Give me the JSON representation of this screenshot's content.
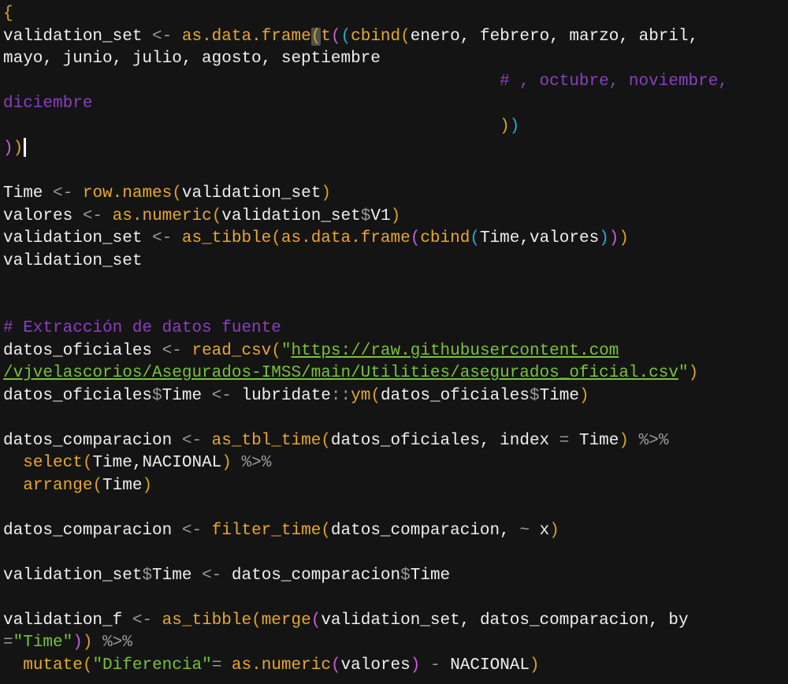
{
  "editor": {
    "lines": [
      [
        {
          "t": "{",
          "c": "b1"
        }
      ],
      [
        {
          "t": "validation_set ",
          "c": "def"
        },
        {
          "t": "<-",
          "c": "op"
        },
        {
          "t": " ",
          "c": "def"
        },
        {
          "t": "as.data.frame",
          "c": "fun"
        },
        {
          "t": "(",
          "c": "b1",
          "m": 1
        },
        {
          "t": "t",
          "c": "fun"
        },
        {
          "t": "(",
          "c": "b2"
        },
        {
          "t": "(",
          "c": "b3"
        },
        {
          "t": "cbind",
          "c": "fun"
        },
        {
          "t": "(",
          "c": "b1"
        },
        {
          "t": "enero, febrero, marzo, abril,",
          "c": "def"
        }
      ],
      [
        {
          "t": "mayo, junio, julio, agosto, septiembre",
          "c": "def"
        }
      ],
      [
        {
          "t": "                                                  # , octubre, noviembre,",
          "c": "com"
        }
      ],
      [
        {
          "t": "diciembre",
          "c": "com"
        }
      ],
      [
        {
          "t": "                                                  ",
          "c": "def"
        },
        {
          "t": ")",
          "c": "b1"
        },
        {
          "t": ")",
          "c": "b3"
        }
      ],
      [
        {
          "t": ")",
          "c": "b2"
        },
        {
          "t": ")",
          "c": "b1"
        },
        {
          "t": "",
          "c": "def",
          "cur": 1
        }
      ],
      [],
      [
        {
          "t": "Time ",
          "c": "def"
        },
        {
          "t": "<-",
          "c": "op"
        },
        {
          "t": " ",
          "c": "def"
        },
        {
          "t": "row.names",
          "c": "fun"
        },
        {
          "t": "(",
          "c": "b1"
        },
        {
          "t": "validation_set",
          "c": "def"
        },
        {
          "t": ")",
          "c": "b1"
        }
      ],
      [
        {
          "t": "valores ",
          "c": "def"
        },
        {
          "t": "<-",
          "c": "op"
        },
        {
          "t": " ",
          "c": "def"
        },
        {
          "t": "as.numeric",
          "c": "fun"
        },
        {
          "t": "(",
          "c": "b1"
        },
        {
          "t": "validation_set",
          "c": "def"
        },
        {
          "t": "$",
          "c": "op"
        },
        {
          "t": "V1",
          "c": "def"
        },
        {
          "t": ")",
          "c": "b1"
        }
      ],
      [
        {
          "t": "validation_set ",
          "c": "def"
        },
        {
          "t": "<-",
          "c": "op"
        },
        {
          "t": " ",
          "c": "def"
        },
        {
          "t": "as_tibble",
          "c": "fun"
        },
        {
          "t": "(",
          "c": "b1"
        },
        {
          "t": "as.data.frame",
          "c": "fun"
        },
        {
          "t": "(",
          "c": "b2"
        },
        {
          "t": "cbind",
          "c": "fun"
        },
        {
          "t": "(",
          "c": "b3"
        },
        {
          "t": "Time,valores",
          "c": "def"
        },
        {
          "t": ")",
          "c": "b3"
        },
        {
          "t": ")",
          "c": "b2"
        },
        {
          "t": ")",
          "c": "b1"
        }
      ],
      [
        {
          "t": "validation_set",
          "c": "def"
        }
      ],
      [],
      [],
      [
        {
          "t": "# Extracción de datos fuente",
          "c": "com"
        }
      ],
      [
        {
          "t": "datos_oficiales ",
          "c": "def"
        },
        {
          "t": "<-",
          "c": "op"
        },
        {
          "t": " ",
          "c": "def"
        },
        {
          "t": "read_csv",
          "c": "fun"
        },
        {
          "t": "(",
          "c": "b1"
        },
        {
          "t": "\"",
          "c": "str"
        },
        {
          "t": "https://raw.githubusercontent.com",
          "c": "url"
        }
      ],
      [
        {
          "t": "/vjvelascorios/Asegurados-IMSS/main/Utilities/asegurados_oficial.csv",
          "c": "url"
        },
        {
          "t": "\"",
          "c": "str"
        },
        {
          "t": ")",
          "c": "b1"
        }
      ],
      [
        {
          "t": "datos_oficiales",
          "c": "def"
        },
        {
          "t": "$",
          "c": "op"
        },
        {
          "t": "Time ",
          "c": "def"
        },
        {
          "t": "<-",
          "c": "op"
        },
        {
          "t": " lubridate",
          "c": "def"
        },
        {
          "t": "::",
          "c": "op"
        },
        {
          "t": "ym",
          "c": "fun"
        },
        {
          "t": "(",
          "c": "b1"
        },
        {
          "t": "datos_oficiales",
          "c": "def"
        },
        {
          "t": "$",
          "c": "op"
        },
        {
          "t": "Time",
          "c": "def"
        },
        {
          "t": ")",
          "c": "b1"
        }
      ],
      [],
      [
        {
          "t": "datos_comparacion ",
          "c": "def"
        },
        {
          "t": "<-",
          "c": "op"
        },
        {
          "t": " ",
          "c": "def"
        },
        {
          "t": "as_tbl_time",
          "c": "fun"
        },
        {
          "t": "(",
          "c": "b1"
        },
        {
          "t": "datos_oficiales, index ",
          "c": "def"
        },
        {
          "t": "=",
          "c": "op"
        },
        {
          "t": " Time",
          "c": "def"
        },
        {
          "t": ")",
          "c": "b1"
        },
        {
          "t": " ",
          "c": "def"
        },
        {
          "t": "%>%",
          "c": "op"
        }
      ],
      [
        {
          "t": "  ",
          "c": "def"
        },
        {
          "t": "select",
          "c": "fun"
        },
        {
          "t": "(",
          "c": "b1"
        },
        {
          "t": "Time,NACIONAL",
          "c": "def"
        },
        {
          "t": ")",
          "c": "b1"
        },
        {
          "t": " ",
          "c": "def"
        },
        {
          "t": "%>%",
          "c": "op"
        }
      ],
      [
        {
          "t": "  ",
          "c": "def"
        },
        {
          "t": "arrange",
          "c": "fun"
        },
        {
          "t": "(",
          "c": "b1"
        },
        {
          "t": "Time",
          "c": "def"
        },
        {
          "t": ")",
          "c": "b1"
        }
      ],
      [],
      [
        {
          "t": "datos_comparacion ",
          "c": "def"
        },
        {
          "t": "<-",
          "c": "op"
        },
        {
          "t": " ",
          "c": "def"
        },
        {
          "t": "filter_time",
          "c": "fun"
        },
        {
          "t": "(",
          "c": "b1"
        },
        {
          "t": "datos_comparacion, ",
          "c": "def"
        },
        {
          "t": "~",
          "c": "op"
        },
        {
          "t": " x",
          "c": "def"
        },
        {
          "t": ")",
          "c": "b1"
        }
      ],
      [],
      [
        {
          "t": "validation_set",
          "c": "def"
        },
        {
          "t": "$",
          "c": "op"
        },
        {
          "t": "Time ",
          "c": "def"
        },
        {
          "t": "<-",
          "c": "op"
        },
        {
          "t": " datos_comparacion",
          "c": "def"
        },
        {
          "t": "$",
          "c": "op"
        },
        {
          "t": "Time",
          "c": "def"
        }
      ],
      [],
      [
        {
          "t": "validation_f ",
          "c": "def"
        },
        {
          "t": "<-",
          "c": "op"
        },
        {
          "t": " ",
          "c": "def"
        },
        {
          "t": "as_tibble",
          "c": "fun"
        },
        {
          "t": "(",
          "c": "b1"
        },
        {
          "t": "merge",
          "c": "fun"
        },
        {
          "t": "(",
          "c": "b2"
        },
        {
          "t": "validation_set, datos_comparacion, by",
          "c": "def"
        }
      ],
      [
        {
          "t": "=",
          "c": "op"
        },
        {
          "t": "\"Time\"",
          "c": "str"
        },
        {
          "t": ")",
          "c": "b2"
        },
        {
          "t": ")",
          "c": "b1"
        },
        {
          "t": " ",
          "c": "def"
        },
        {
          "t": "%>%",
          "c": "op"
        }
      ],
      [
        {
          "t": "  ",
          "c": "def"
        },
        {
          "t": "mutate",
          "c": "fun"
        },
        {
          "t": "(",
          "c": "b1"
        },
        {
          "t": "\"Diferencia\"",
          "c": "str"
        },
        {
          "t": "=",
          "c": "op"
        },
        {
          "t": " ",
          "c": "def"
        },
        {
          "t": "as.numeric",
          "c": "fun"
        },
        {
          "t": "(",
          "c": "b2"
        },
        {
          "t": "valores",
          "c": "def"
        },
        {
          "t": ")",
          "c": "b2"
        },
        {
          "t": " ",
          "c": "def"
        },
        {
          "t": "-",
          "c": "op"
        },
        {
          "t": " NACIONAL",
          "c": "def"
        },
        {
          "t": ")",
          "c": "b1"
        }
      ]
    ]
  }
}
